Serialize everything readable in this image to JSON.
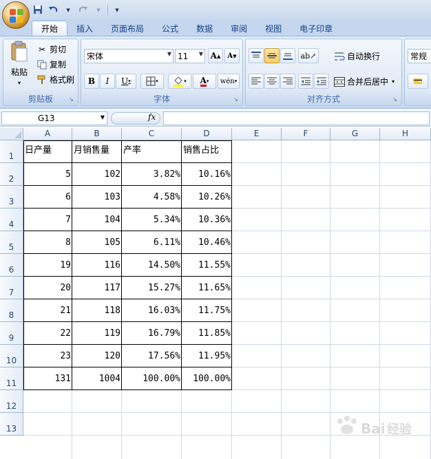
{
  "qat": {
    "save_icon": "save-icon",
    "undo_icon": "undo-icon",
    "redo_icon": "redo-icon",
    "customize_icon": "qat-dropdown-icon"
  },
  "tabs": [
    {
      "label": "开始",
      "active": true
    },
    {
      "label": "插入",
      "active": false
    },
    {
      "label": "页面布局",
      "active": false
    },
    {
      "label": "公式",
      "active": false
    },
    {
      "label": "数据",
      "active": false
    },
    {
      "label": "审阅",
      "active": false
    },
    {
      "label": "视图",
      "active": false
    },
    {
      "label": "电子印章",
      "active": false
    }
  ],
  "clipboard": {
    "paste_label": "粘贴",
    "cut_label": "剪切",
    "copy_label": "复制",
    "format_painter_label": "格式刷",
    "group_label": "剪贴板"
  },
  "font": {
    "font_name": "宋体",
    "font_size": "11",
    "grow_label": "A",
    "shrink_label": "A",
    "bold_label": "B",
    "italic_label": "I",
    "underline_label": "U",
    "phonetic_label": "wén",
    "group_label": "字体"
  },
  "alignment": {
    "wrap_text_label": "自动换行",
    "merge_center_label": "合并后居中",
    "group_label": "对齐方式"
  },
  "number": {
    "format": "常规"
  },
  "formula_bar": {
    "name_box": "G13",
    "fx_label": "fx",
    "formula": ""
  },
  "columns": [
    "A",
    "B",
    "C",
    "D",
    "E",
    "F",
    "G",
    "H"
  ],
  "rows": [
    "1",
    "2",
    "3",
    "4",
    "5",
    "6",
    "7",
    "8",
    "9",
    "10",
    "11",
    "12",
    "13"
  ],
  "table": {
    "headers": [
      "日产量",
      "月销售量",
      "产率",
      "销售占比"
    ],
    "rows": [
      [
        "5",
        "102",
        "3.82%",
        "10.16%"
      ],
      [
        "6",
        "103",
        "4.58%",
        "10.26%"
      ],
      [
        "7",
        "104",
        "5.34%",
        "10.36%"
      ],
      [
        "8",
        "105",
        "6.11%",
        "10.46%"
      ],
      [
        "19",
        "116",
        "14.50%",
        "11.55%"
      ],
      [
        "20",
        "117",
        "15.27%",
        "11.65%"
      ],
      [
        "21",
        "118",
        "16.03%",
        "11.75%"
      ],
      [
        "22",
        "119",
        "16.79%",
        "11.85%"
      ],
      [
        "23",
        "120",
        "17.56%",
        "11.95%"
      ],
      [
        "131",
        "1004",
        "100.00%",
        "100.00%"
      ]
    ]
  },
  "watermark": "Baidu 经验"
}
